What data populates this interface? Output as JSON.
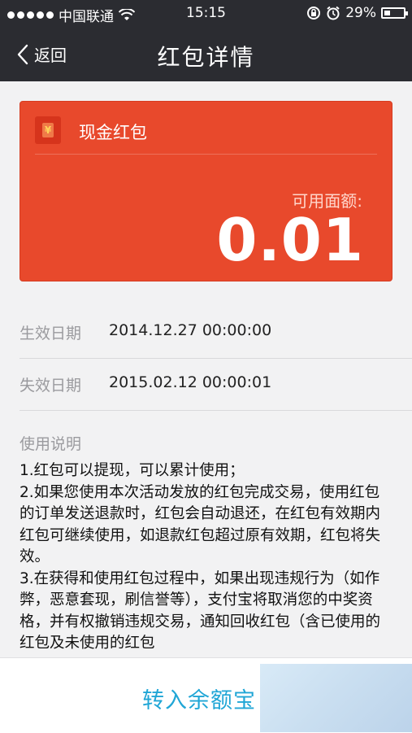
{
  "status_bar": {
    "carrier": "中国联通",
    "time": "15:15",
    "battery_percent": "29%",
    "icons": [
      "signal-dots-icon",
      "wifi-icon",
      "rotation-lock-icon",
      "alarm-icon",
      "battery-icon"
    ]
  },
  "nav": {
    "back_label": "返回",
    "title": "红包详情"
  },
  "card": {
    "type_label": "现金红包",
    "available_label": "可用面额:",
    "amount": "0.01",
    "icon": "yuan-coupon-icon",
    "icon_glyph": "¥",
    "color": "#e8492c"
  },
  "details": {
    "effective_label": "生效日期",
    "effective_value": "2014.12.27 00:00:00",
    "expiry_label": "失效日期",
    "expiry_value": "2015.02.12 00:00:01"
  },
  "usage": {
    "title": "使用说明",
    "lines": [
      "1.红包可以提现，可以累计使用；",
      "2.如果您使用本次活动发放的红包完成交易，使用红包的订单发送退款时，红包会自动退还，在红包有效期内红包可继续使用，如退款红包超过原有效期，红包将失效。",
      "3.在获得和使用红包过程中，如果出现违规行为（如作弊，恶意套现，刷信誉等），支付宝将取消您的中奖资格，并有权撤销违规交易，通知回收红包（含已使用的红包及未使用的红包"
    ]
  },
  "bottom": {
    "transfer_label": "转入余额宝",
    "accent_color": "#20a6d6"
  }
}
